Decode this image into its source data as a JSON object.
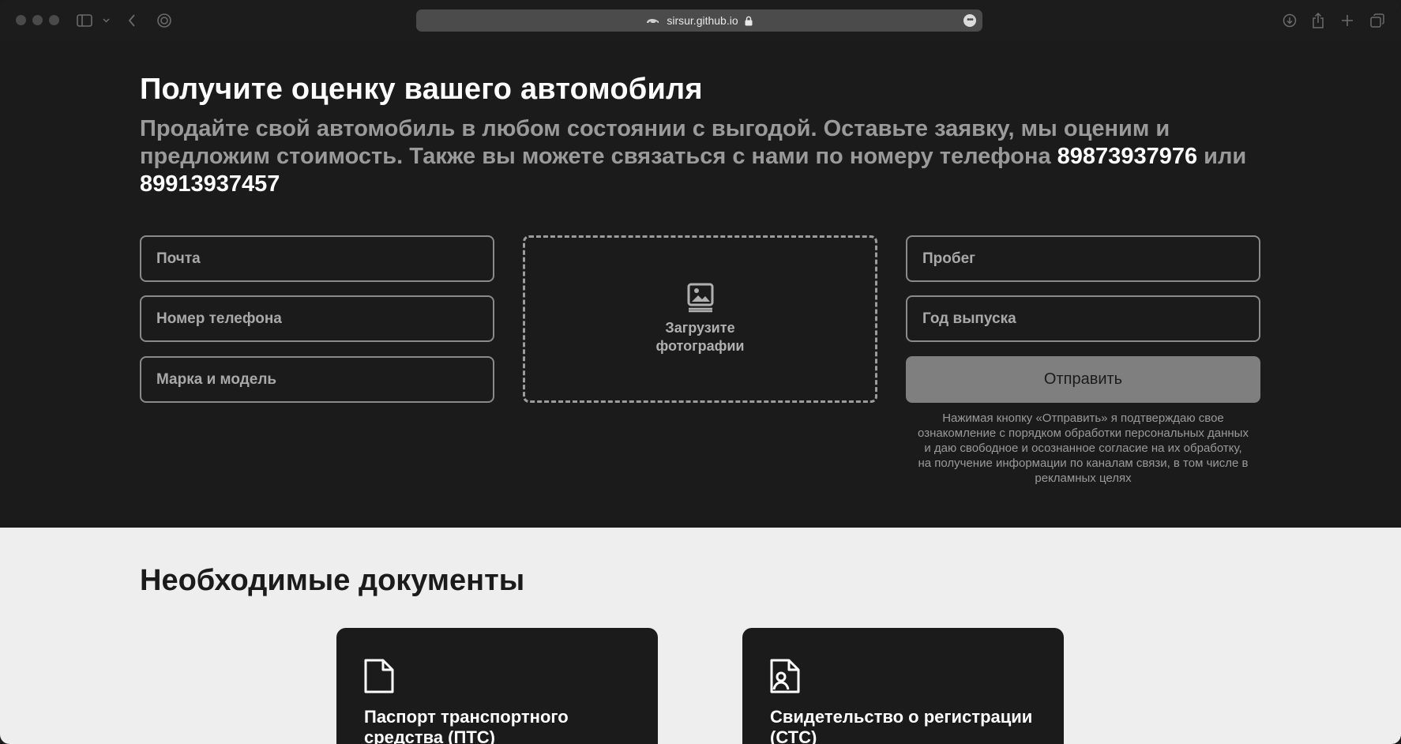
{
  "browser": {
    "url": "sirsur.github.io",
    "icons": [
      "sidebar-icon",
      "chevron-down-icon",
      "back-icon",
      "privacy-icon",
      "lock-icon",
      "more-icon",
      "download-icon",
      "share-icon",
      "new-tab-icon",
      "tabs-overview-icon"
    ]
  },
  "hero": {
    "title": "Получите оценку вашего автомобиля",
    "subtitle_text": "Продайте свой автомобиль в любом состоянии с выгодой. Оставьте заявку, мы оценим и предложим стоимость. Также вы можете связаться с нами по номеру телефона ",
    "phone1": "89873937976",
    "or_text": " или ",
    "phone2": "89913937457"
  },
  "form": {
    "email_placeholder": "Почта",
    "phone_placeholder": "Номер телефона",
    "model_placeholder": "Марка и модель",
    "upload_line1": "Загрузите",
    "upload_line2": "фотографии",
    "mileage_placeholder": "Пробег",
    "year_placeholder": "Год выпуска",
    "submit_label": "Отправить",
    "consent_text": "Нажимая кнопку «Отправить» я подтверждаю свое ознакомление с порядком обработки персональных данных и даю свободное и осознанное согласие на их обработку, на получение информации по каналам связи, в том числе в рекламных целях"
  },
  "docs": {
    "title": "Необходимые документы",
    "cards": [
      {
        "label": "Паспорт транспортного средства (ПТС)",
        "icon": "document-icon"
      },
      {
        "label": "Свидетельство о регистрации (СТС)",
        "icon": "registration-document-icon"
      }
    ]
  },
  "colors": {
    "background_dark": "#1b1b1b",
    "background_light": "#eeeeee",
    "muted_text": "#9a9a9a",
    "button": "#7f7f7f"
  }
}
